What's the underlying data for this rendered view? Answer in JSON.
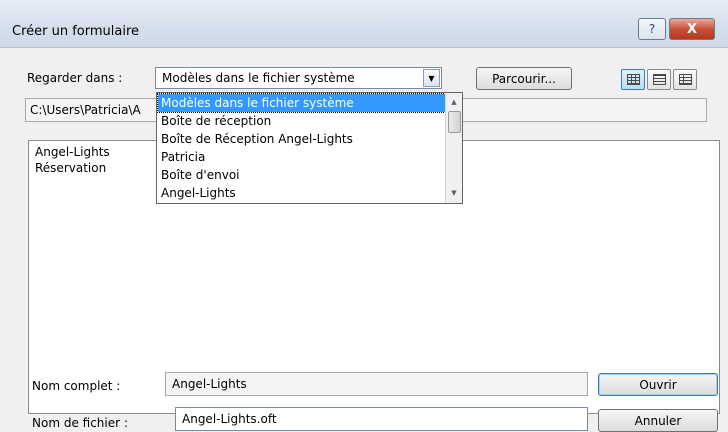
{
  "window": {
    "title": "Créer un formulaire",
    "help_label": "?",
    "close_label": "X"
  },
  "look_in": {
    "label": "Regarder dans :",
    "selected": "Modèles dans le fichier système",
    "browse_label": "Parcourir..."
  },
  "path": {
    "value": "C:\\Users\\Patricia\\A"
  },
  "dropdown": {
    "options": [
      "Modèles dans le fichier système",
      "Boîte de réception",
      "Boîte de Réception Angel-Lights",
      "Patricia",
      "Boîte d'envoi",
      "Angel-Lights"
    ]
  },
  "file_list": {
    "items": [
      "Angel-Lights",
      "Réservation"
    ]
  },
  "full_name": {
    "label": "Nom complet :",
    "value": "Angel-Lights"
  },
  "file_name": {
    "label": "Nom de fichier :",
    "value": "Angel-Lights.oft"
  },
  "actions": {
    "open_label": "Ouvrir",
    "cancel_label": "Annuler"
  }
}
